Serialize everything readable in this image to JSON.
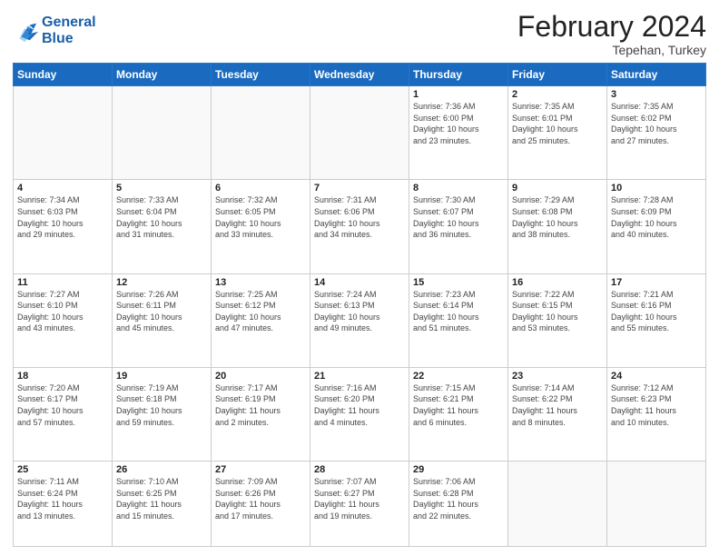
{
  "header": {
    "logo_line1": "General",
    "logo_line2": "Blue",
    "title": "February 2024",
    "subtitle": "Tepehan, Turkey"
  },
  "columns": [
    "Sunday",
    "Monday",
    "Tuesday",
    "Wednesday",
    "Thursday",
    "Friday",
    "Saturday"
  ],
  "weeks": [
    [
      {
        "day": "",
        "info": "",
        "empty": true
      },
      {
        "day": "",
        "info": "",
        "empty": true
      },
      {
        "day": "",
        "info": "",
        "empty": true
      },
      {
        "day": "",
        "info": "",
        "empty": true
      },
      {
        "day": "1",
        "info": "Sunrise: 7:36 AM\nSunset: 6:00 PM\nDaylight: 10 hours\nand 23 minutes."
      },
      {
        "day": "2",
        "info": "Sunrise: 7:35 AM\nSunset: 6:01 PM\nDaylight: 10 hours\nand 25 minutes."
      },
      {
        "day": "3",
        "info": "Sunrise: 7:35 AM\nSunset: 6:02 PM\nDaylight: 10 hours\nand 27 minutes."
      }
    ],
    [
      {
        "day": "4",
        "info": "Sunrise: 7:34 AM\nSunset: 6:03 PM\nDaylight: 10 hours\nand 29 minutes."
      },
      {
        "day": "5",
        "info": "Sunrise: 7:33 AM\nSunset: 6:04 PM\nDaylight: 10 hours\nand 31 minutes."
      },
      {
        "day": "6",
        "info": "Sunrise: 7:32 AM\nSunset: 6:05 PM\nDaylight: 10 hours\nand 33 minutes."
      },
      {
        "day": "7",
        "info": "Sunrise: 7:31 AM\nSunset: 6:06 PM\nDaylight: 10 hours\nand 34 minutes."
      },
      {
        "day": "8",
        "info": "Sunrise: 7:30 AM\nSunset: 6:07 PM\nDaylight: 10 hours\nand 36 minutes."
      },
      {
        "day": "9",
        "info": "Sunrise: 7:29 AM\nSunset: 6:08 PM\nDaylight: 10 hours\nand 38 minutes."
      },
      {
        "day": "10",
        "info": "Sunrise: 7:28 AM\nSunset: 6:09 PM\nDaylight: 10 hours\nand 40 minutes."
      }
    ],
    [
      {
        "day": "11",
        "info": "Sunrise: 7:27 AM\nSunset: 6:10 PM\nDaylight: 10 hours\nand 43 minutes."
      },
      {
        "day": "12",
        "info": "Sunrise: 7:26 AM\nSunset: 6:11 PM\nDaylight: 10 hours\nand 45 minutes."
      },
      {
        "day": "13",
        "info": "Sunrise: 7:25 AM\nSunset: 6:12 PM\nDaylight: 10 hours\nand 47 minutes."
      },
      {
        "day": "14",
        "info": "Sunrise: 7:24 AM\nSunset: 6:13 PM\nDaylight: 10 hours\nand 49 minutes."
      },
      {
        "day": "15",
        "info": "Sunrise: 7:23 AM\nSunset: 6:14 PM\nDaylight: 10 hours\nand 51 minutes."
      },
      {
        "day": "16",
        "info": "Sunrise: 7:22 AM\nSunset: 6:15 PM\nDaylight: 10 hours\nand 53 minutes."
      },
      {
        "day": "17",
        "info": "Sunrise: 7:21 AM\nSunset: 6:16 PM\nDaylight: 10 hours\nand 55 minutes."
      }
    ],
    [
      {
        "day": "18",
        "info": "Sunrise: 7:20 AM\nSunset: 6:17 PM\nDaylight: 10 hours\nand 57 minutes."
      },
      {
        "day": "19",
        "info": "Sunrise: 7:19 AM\nSunset: 6:18 PM\nDaylight: 10 hours\nand 59 minutes."
      },
      {
        "day": "20",
        "info": "Sunrise: 7:17 AM\nSunset: 6:19 PM\nDaylight: 11 hours\nand 2 minutes."
      },
      {
        "day": "21",
        "info": "Sunrise: 7:16 AM\nSunset: 6:20 PM\nDaylight: 11 hours\nand 4 minutes."
      },
      {
        "day": "22",
        "info": "Sunrise: 7:15 AM\nSunset: 6:21 PM\nDaylight: 11 hours\nand 6 minutes."
      },
      {
        "day": "23",
        "info": "Sunrise: 7:14 AM\nSunset: 6:22 PM\nDaylight: 11 hours\nand 8 minutes."
      },
      {
        "day": "24",
        "info": "Sunrise: 7:12 AM\nSunset: 6:23 PM\nDaylight: 11 hours\nand 10 minutes."
      }
    ],
    [
      {
        "day": "25",
        "info": "Sunrise: 7:11 AM\nSunset: 6:24 PM\nDaylight: 11 hours\nand 13 minutes."
      },
      {
        "day": "26",
        "info": "Sunrise: 7:10 AM\nSunset: 6:25 PM\nDaylight: 11 hours\nand 15 minutes."
      },
      {
        "day": "27",
        "info": "Sunrise: 7:09 AM\nSunset: 6:26 PM\nDaylight: 11 hours\nand 17 minutes."
      },
      {
        "day": "28",
        "info": "Sunrise: 7:07 AM\nSunset: 6:27 PM\nDaylight: 11 hours\nand 19 minutes."
      },
      {
        "day": "29",
        "info": "Sunrise: 7:06 AM\nSunset: 6:28 PM\nDaylight: 11 hours\nand 22 minutes."
      },
      {
        "day": "",
        "info": "",
        "empty": true
      },
      {
        "day": "",
        "info": "",
        "empty": true
      }
    ]
  ]
}
